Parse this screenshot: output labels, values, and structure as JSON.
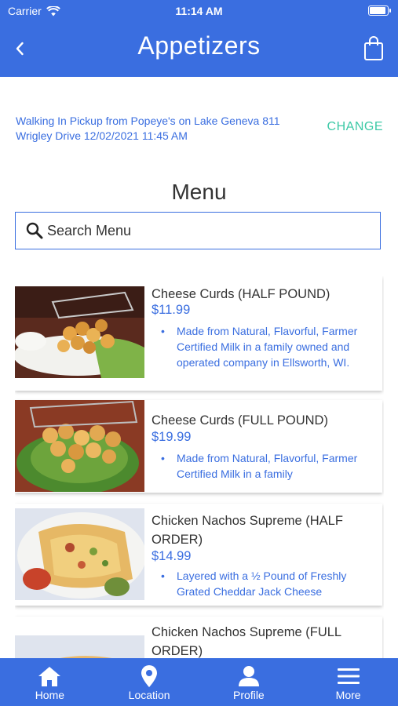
{
  "status_bar": {
    "carrier": "Carrier",
    "time": "11:14 AM"
  },
  "header": {
    "title": "Appetizers",
    "back_icon": "chevron-left-icon",
    "cart_icon": "shopping-bag-icon"
  },
  "pickup": {
    "text": "Walking In Pickup from Popeye's on Lake Geneva 811 Wrigley Drive 12/02/2021 11:45 AM",
    "change_label": "CHANGE"
  },
  "menu": {
    "title": "Menu",
    "search_placeholder": "Search Menu",
    "items": [
      {
        "name": "Cheese Curds (HALF POUND)",
        "price": "$11.99",
        "description": "Made from Natural, Flavorful, Farmer Certified Milk in a family owned and operated company in Ellsworth, WI."
      },
      {
        "name": "Cheese Curds (FULL POUND)",
        "price": "$19.99",
        "description": "Made from Natural, Flavorful, Farmer Certified Milk in a family"
      },
      {
        "name": "Chicken Nachos Supreme (HALF ORDER)",
        "price": "$14.99",
        "description": "Layered with a ½ Pound of Freshly Grated Cheddar Jack Cheese"
      },
      {
        "name": "Chicken Nachos Supreme (FULL ORDER)",
        "price": "",
        "description": ""
      }
    ]
  },
  "tabbar": {
    "tabs": [
      {
        "label": "Home",
        "icon": "home-icon"
      },
      {
        "label": "Location",
        "icon": "location-pin-icon"
      },
      {
        "label": "Profile",
        "icon": "person-icon"
      },
      {
        "label": "More",
        "icon": "menu-icon"
      }
    ]
  },
  "colors": {
    "primary": "#3a6ee0",
    "accent": "#3cc9a6",
    "text": "#333333"
  }
}
